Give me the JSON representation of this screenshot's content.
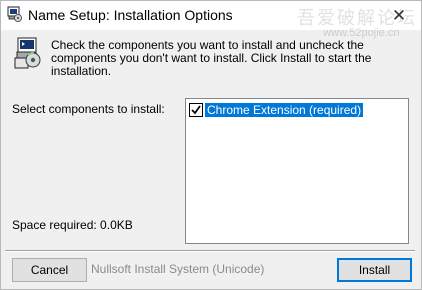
{
  "window": {
    "title": "Name Setup: Installation Options",
    "close_glyph": "✕"
  },
  "watermark": {
    "text": "吾爱破解论坛",
    "subtext": "www.52pojie.cn"
  },
  "header": {
    "icon": "installer-disk-icon",
    "description": "Check the components you want to install and uncheck the components you don't want to install. Click Install to start the installation."
  },
  "components": {
    "select_label": "Select components to install:",
    "items": [
      {
        "label": "Chrome Extension (required)",
        "checked": true,
        "selected": true
      }
    ],
    "space_required": "Space required: 0.0KB"
  },
  "footer": {
    "cancel_label": "Cancel",
    "branding": "Nullsoft Install System (Unicode)",
    "install_label": "Install"
  },
  "colors": {
    "selection": "#0078d7",
    "background": "#f0f0f0"
  }
}
